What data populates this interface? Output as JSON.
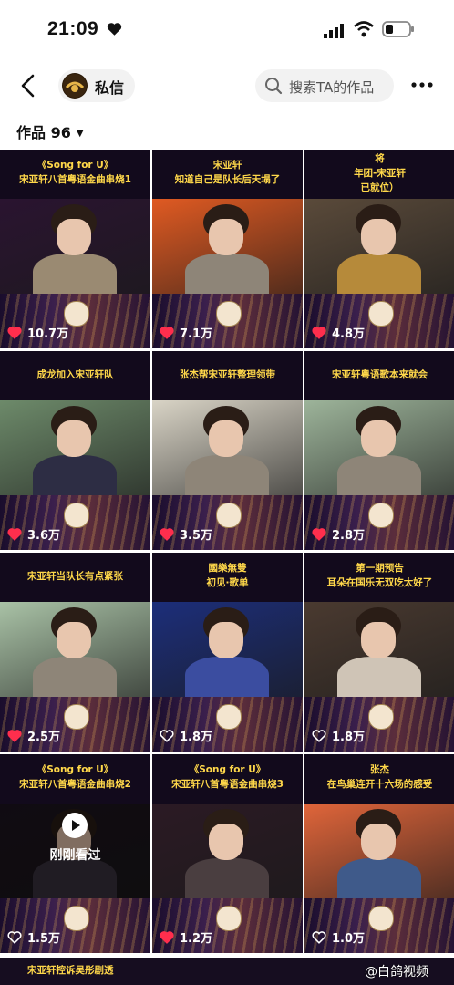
{
  "status_bar": {
    "time": "21:09"
  },
  "header": {
    "dm_label": "私信",
    "search_placeholder": "搜索TA的作品"
  },
  "works": {
    "label": "作品 96"
  },
  "colors": {
    "title_yellow": "#ffd84a",
    "heart_red": "#ff2e4d",
    "panel_dark": "#1b1226"
  },
  "grid": [
    {
      "lines": [
        "《Song for U》",
        "宋亚轩八首粤语金曲串烧1"
      ],
      "likes": "10.7万",
      "liked": true,
      "bg": "#2a1430",
      "body": "#9a8a72"
    },
    {
      "lines": [
        "宋亚轩",
        "知道自己是队长后天塌了"
      ],
      "likes": "7.1万",
      "liked": true,
      "bg": "#e05a22",
      "body": "#8e8578"
    },
    {
      "lines": [
        "将",
        "年团-宋亚轩",
        "已就位）"
      ],
      "likes": "4.8万",
      "liked": true,
      "bg": "#5a4a3a",
      "body": "#b68a3a"
    },
    {
      "lines": [
        "成龙加入宋亚轩队"
      ],
      "likes": "3.6万",
      "liked": true,
      "bg": "#6d8a6a",
      "body": "#2d2d44"
    },
    {
      "lines": [
        "张杰帮宋亚轩整理领带"
      ],
      "likes": "3.5万",
      "liked": true,
      "bg": "#d9d4c6",
      "body": "#8e8578"
    },
    {
      "lines": [
        "宋亚轩粤语歌本来就会"
      ],
      "likes": "2.8万",
      "liked": true,
      "bg": "#9db49a",
      "body": "#8e8578"
    },
    {
      "lines": [
        "宋亚轩当队长有点紧张"
      ],
      "likes": "2.5万",
      "liked": true,
      "bg": "#a9c2a6",
      "body": "#8e8578"
    },
    {
      "lines": [
        "國樂無雙",
        "初见·歌单"
      ],
      "likes": "1.8万",
      "liked": false,
      "bg": "#1c2e7a",
      "body": "#3b4da0"
    },
    {
      "lines": [
        "第一期预告",
        "耳朵在国乐无双吃太好了"
      ],
      "likes": "1.8万",
      "liked": false,
      "bg": "#4a3a30",
      "body": "#cfc4b6"
    },
    {
      "lines": [
        "《Song for U》",
        "宋亚轩八首粤语金曲串烧2"
      ],
      "likes": "1.5万",
      "liked": false,
      "bg": "#1e1420",
      "body": "#3b3340",
      "watched": "刚刚看过"
    },
    {
      "lines": [
        "《Song for U》",
        "宋亚轩八首粤语金曲串烧3"
      ],
      "likes": "1.2万",
      "liked": true,
      "bg": "#2b1a24",
      "body": "#4a3e40"
    },
    {
      "lines": [
        "张杰",
        "在鸟巢连开十六场的感受"
      ],
      "likes": "1.0万",
      "liked": false,
      "bg": "#e0653a",
      "body": "#3f5a8a"
    }
  ],
  "footer": {
    "left_title": "宋亚轩控诉吴彤剧透",
    "watermark": "@白鸽视频"
  }
}
